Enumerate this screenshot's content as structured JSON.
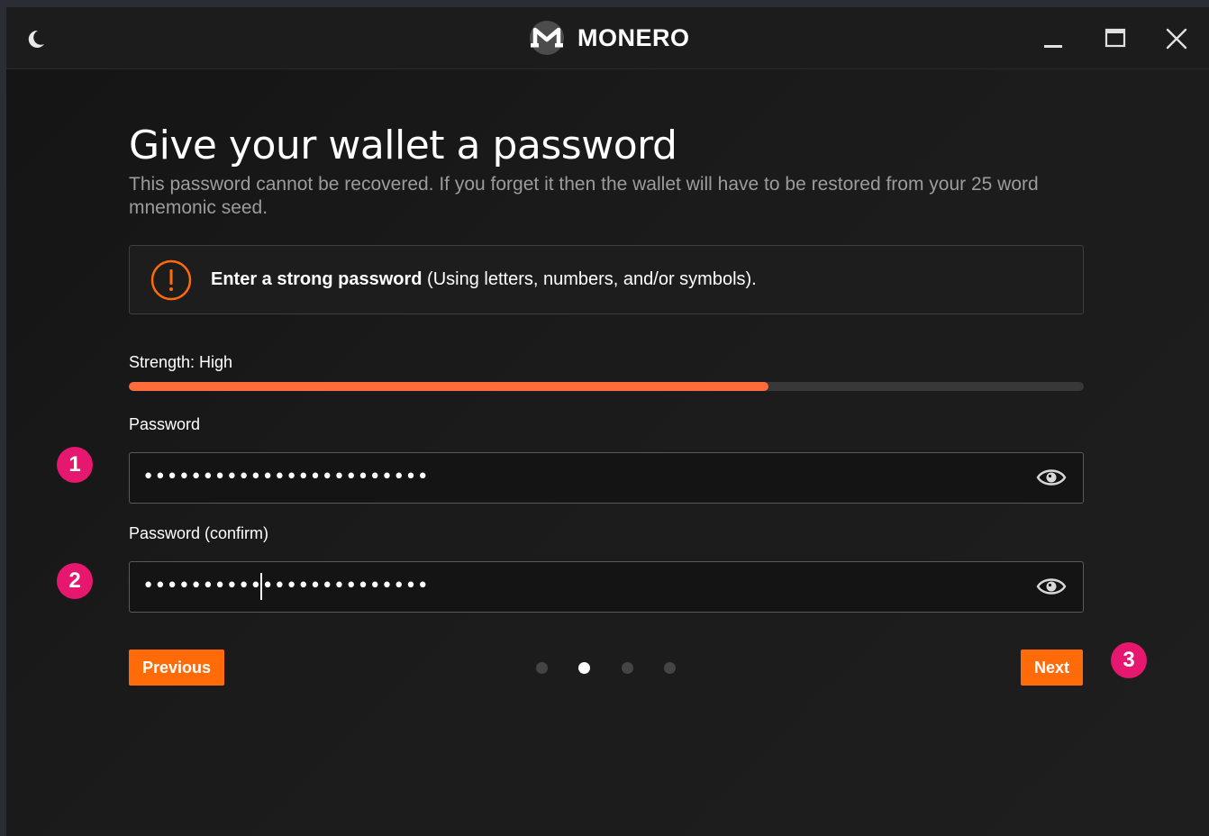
{
  "titlebar": {
    "brand_name": "MONERO",
    "theme_icon": "moon-icon",
    "logo_icon": "monero-logo",
    "minimize_icon": "minimize-icon",
    "maximize_icon": "maximize-icon",
    "close_icon": "close-icon"
  },
  "page": {
    "title": "Give your wallet a password",
    "subtitle": "This password cannot be recovered. If you forget it then the wallet will have to be restored from your 25 word mnemonic seed."
  },
  "warning": {
    "icon": "alert-circle-icon",
    "bold_text": "Enter a strong password",
    "text": " (Using letters, numbers, and/or symbols)."
  },
  "strength": {
    "label": "Strength: High",
    "level_percent": 67
  },
  "password": {
    "label": "Password",
    "value_masked": "••••••••••••••••••••••••",
    "toggle_icon": "eye-icon"
  },
  "password_confirm": {
    "label": "Password (confirm)",
    "value_masked": "••••••••••••••••••••••••",
    "toggle_icon": "eye-icon"
  },
  "navigation": {
    "previous_label": "Previous",
    "next_label": "Next",
    "step_count": 4,
    "active_step": 2
  },
  "annotations": {
    "badge_1": "1",
    "badge_2": "2",
    "badge_3": "3"
  },
  "colors": {
    "accent": "#ff6b09",
    "strength_bar": "#ff6c3c",
    "badge": "#e5176f",
    "background": "#1b1b1b"
  }
}
